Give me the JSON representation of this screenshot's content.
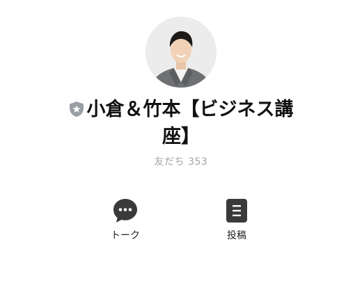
{
  "profile": {
    "avatar_icon": "person-photo",
    "badge_icon": "shield-star-icon",
    "name_line1": "小倉＆竹本【ビジネス講",
    "name_line2": "座】",
    "friends_label": "友だち 353"
  },
  "actions": [
    {
      "label": "トーク",
      "icon": "chat-bubble-icon"
    },
    {
      "label": "投稿",
      "icon": "post-list-icon"
    }
  ],
  "colors": {
    "icon_dark": "#3a3a3a",
    "badge_gray": "#9a9ea4",
    "muted_text": "#a4a4a4"
  }
}
